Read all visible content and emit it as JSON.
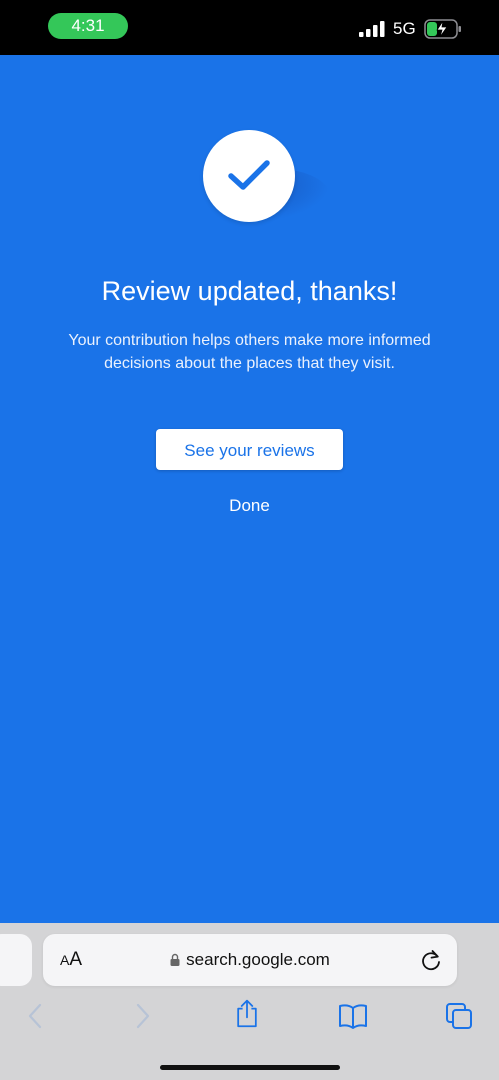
{
  "status_bar": {
    "time": "4:31",
    "network": "5G",
    "icons": [
      "signal-bars-icon",
      "charging-battery-icon"
    ],
    "time_pill_color": "#34c759"
  },
  "confirmation": {
    "icon": "checkmark-icon",
    "title": "Review updated, thanks!",
    "message": "Your contribution helps others make more informed decisions about the places that they visit.",
    "primary_button": "See your reviews",
    "secondary_link": "Done",
    "background_color": "#1a73e8",
    "accent_color": "#1a73e8"
  },
  "browser": {
    "reader_button_small": "A",
    "reader_button_large": "A",
    "url": "search.google.com",
    "icons": [
      "lock-icon",
      "reload-icon",
      "back-arrow-icon",
      "forward-arrow-icon",
      "share-icon",
      "bookmarks-icon",
      "tabs-icon"
    ],
    "tint_color": "#0a84ff"
  }
}
